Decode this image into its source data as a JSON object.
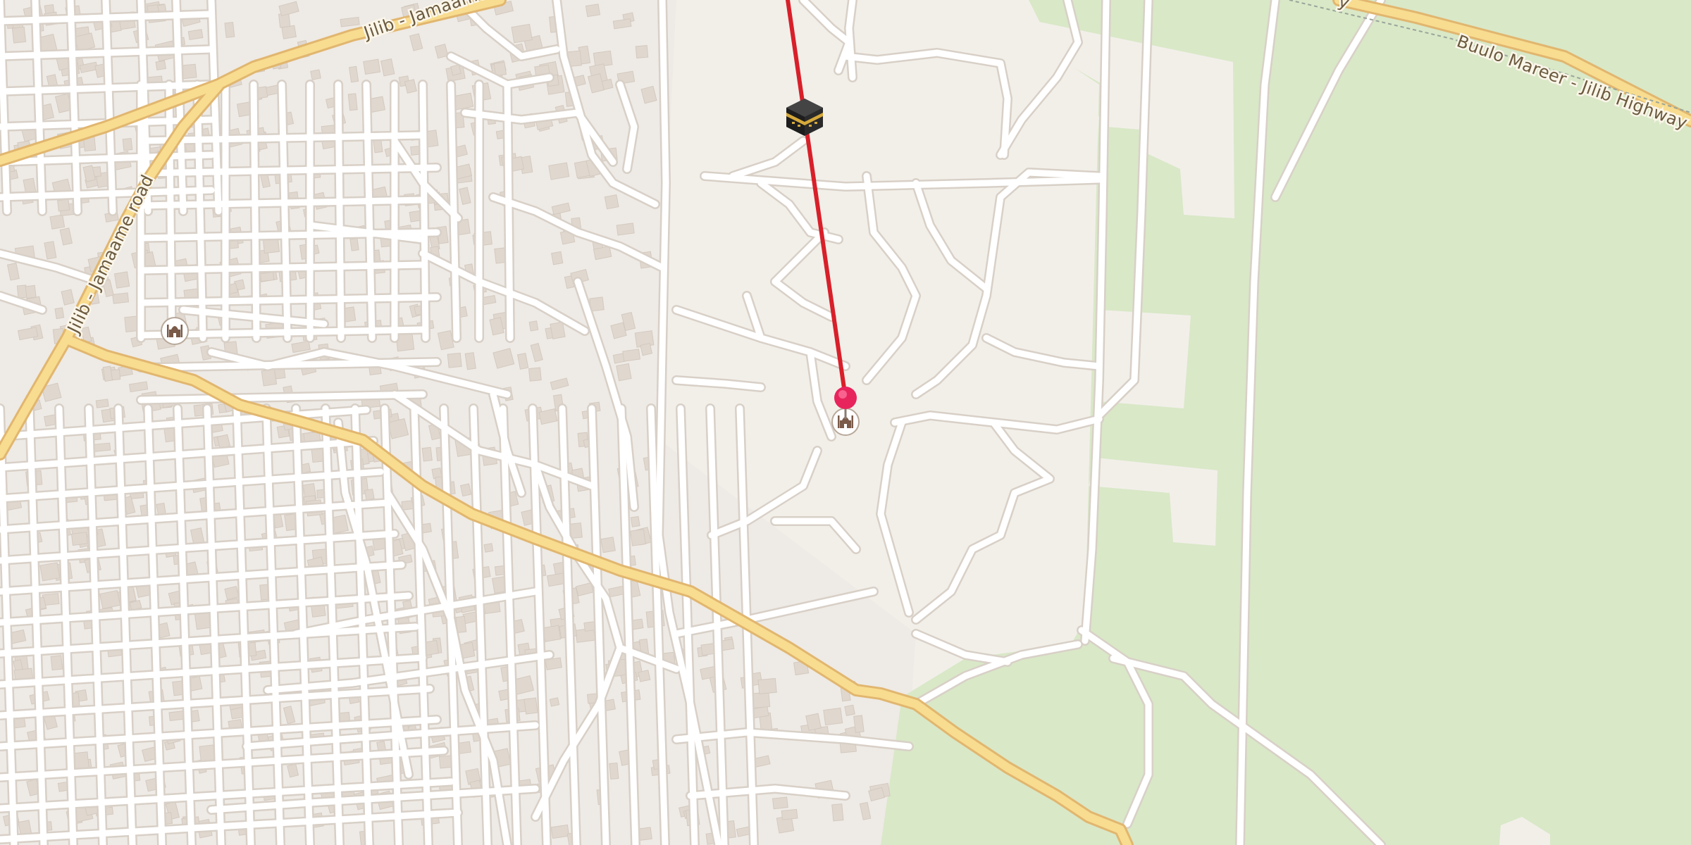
{
  "map": {
    "colors": {
      "background": "#f2efe9",
      "residential": "#e8e4de",
      "building": "#ddd5cd",
      "park": "#d9e8c7",
      "road_casing": "#d6cfc6",
      "road": "#ffffff",
      "highway": "#f8dc8f",
      "highway_casing": "#e4b972",
      "qibla_line": "#d8202a",
      "pin": "#e8245c"
    },
    "road_labels": {
      "jilib_jamaame_top": "Jilib - Jamaame",
      "jilib_jamaame_road": "Jilib - Jamaame road",
      "buulo_mareer_highway": "Buulo Mareer - Jilib Highway",
      "highway_partial": "y"
    },
    "markers": [
      {
        "name": "kaaba-marker",
        "icon": "kaaba-icon"
      },
      {
        "name": "location-pin",
        "icon": "pin-icon"
      },
      {
        "name": "mosque-marker",
        "icon": "mosque-icon"
      },
      {
        "name": "mosque-marker-west",
        "icon": "mosque-icon"
      }
    ]
  }
}
